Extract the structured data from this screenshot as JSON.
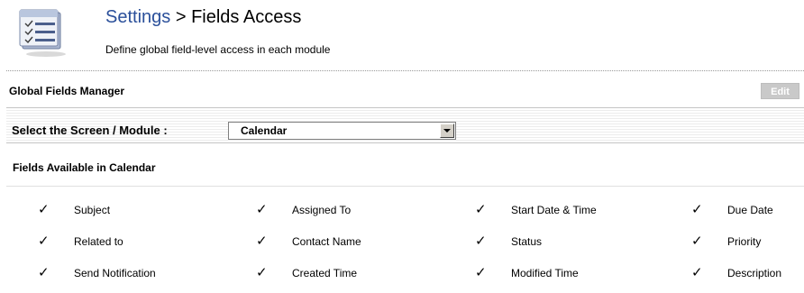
{
  "header": {
    "breadcrumb_link": "Settings",
    "breadcrumb_separator": " > ",
    "page_title": "Fields Access",
    "subtitle": "Define global field-level access in each module",
    "icon": "settings-list-icon"
  },
  "fields_manager": {
    "title": "Global Fields Manager",
    "edit_label": "Edit"
  },
  "module_selector": {
    "label": "Select the Screen / Module :",
    "selected": "Calendar"
  },
  "fields_section": {
    "title": "Fields Available in Calendar",
    "check_icon": "check-mark-icon",
    "columns": [
      [
        "Subject",
        "Related to",
        "Send Notification"
      ],
      [
        "Assigned To",
        "Contact Name",
        "Created Time"
      ],
      [
        "Start Date & Time",
        "Status",
        "Modified Time"
      ],
      [
        "Due Date",
        "Priority",
        "Description"
      ]
    ]
  }
}
